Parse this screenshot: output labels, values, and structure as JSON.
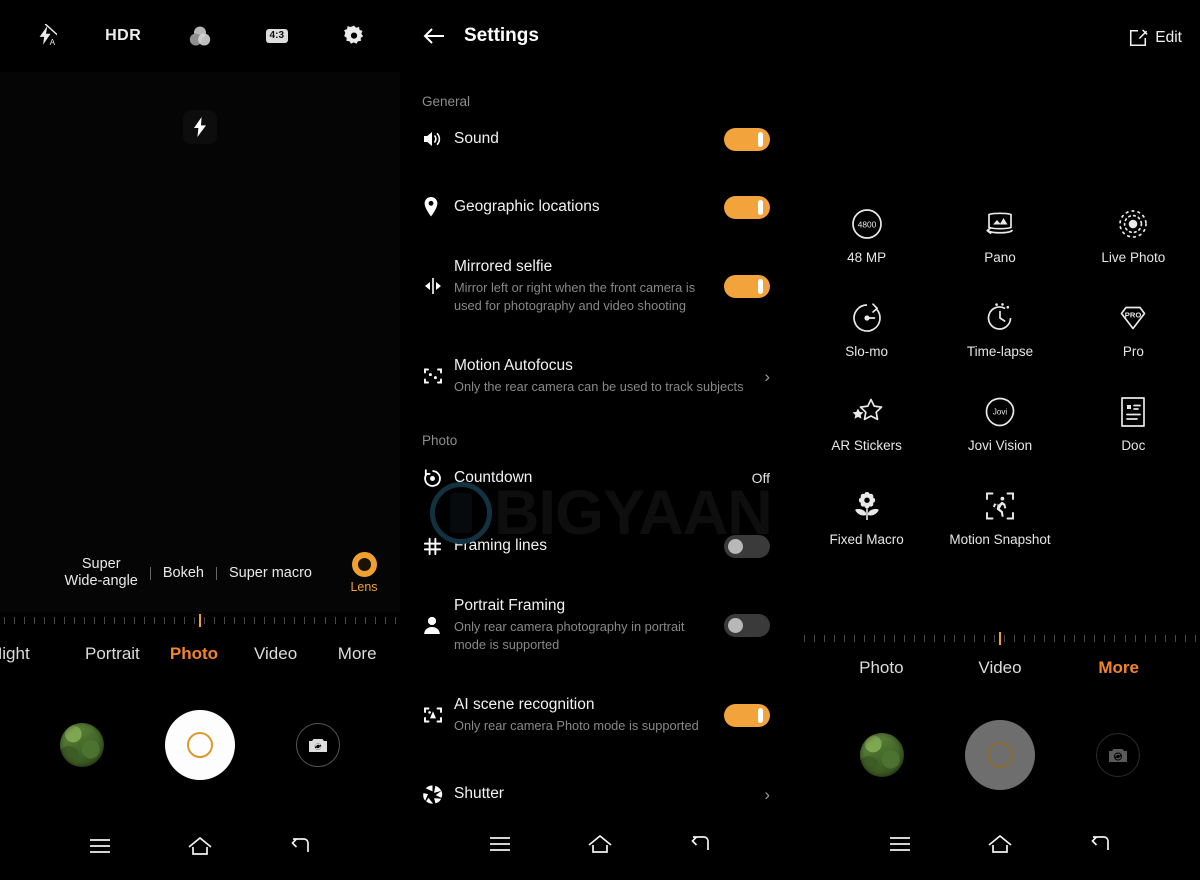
{
  "camera": {
    "topbar": [
      {
        "name": "flash-auto-icon",
        "label": "",
        "icon": "flash-auto"
      },
      {
        "name": "hdr-toggle",
        "label": "HDR",
        "icon": "text"
      },
      {
        "name": "filters-icon",
        "label": "",
        "icon": "filters"
      },
      {
        "name": "aspect-ratio-button",
        "label": "4:3",
        "icon": "ratio"
      },
      {
        "name": "camera-settings-gear",
        "label": "",
        "icon": "gear"
      }
    ],
    "viewfinder_flash_icon": "flash-bolt",
    "lens_options": [
      "Super\nWide-angle",
      "Bokeh",
      "Super macro"
    ],
    "lens_options_flat": [
      "Super Wide-angle",
      "Bokeh",
      "Super macro"
    ],
    "lens_chip_label": "Lens",
    "modes": [
      "Night",
      "Portrait",
      "Photo",
      "Video",
      "More"
    ],
    "active_mode": "Photo",
    "accent_color": "#f0852a",
    "toggle_on_color": "#f3a33c"
  },
  "settings": {
    "title": "Settings",
    "back_icon": "arrow-left-icon",
    "sections": [
      {
        "label": "General",
        "rows": [
          {
            "icon": "speaker-icon",
            "title": "Sound",
            "subtitle": "",
            "control": "toggle",
            "state": "on"
          },
          {
            "icon": "location-pin-icon",
            "title": "Geographic locations",
            "subtitle": "",
            "control": "toggle",
            "state": "on"
          },
          {
            "icon": "mirror-icon",
            "title": "Mirrored selfie",
            "subtitle": "Mirror left or right when the front camera is used for photography and video shooting",
            "control": "toggle",
            "state": "on"
          },
          {
            "icon": "motion-autofocus-icon",
            "title": "Motion Autofocus",
            "subtitle": "Only the rear camera can be used to track subjects",
            "control": "chevron",
            "state": ""
          }
        ]
      },
      {
        "label": "Photo",
        "rows": [
          {
            "icon": "countdown-timer-icon",
            "title": "Countdown",
            "subtitle": "",
            "control": "value",
            "state": "Off"
          },
          {
            "icon": "framing-lines-icon",
            "title": "Framing lines",
            "subtitle": "",
            "control": "toggle",
            "state": "off"
          },
          {
            "icon": "person-icon",
            "title": "Portrait Framing",
            "subtitle": "Only rear camera photography in portrait mode is supported",
            "control": "toggle",
            "state": "off"
          },
          {
            "icon": "ai-scene-icon",
            "title": "AI scene recognition",
            "subtitle": "Only rear camera Photo mode is supported",
            "control": "toggle",
            "state": "on"
          },
          {
            "icon": "shutter-aperture-icon",
            "title": "Shutter",
            "subtitle": "",
            "control": "chevron",
            "state": ""
          }
        ]
      }
    ]
  },
  "more_modes": {
    "edit_label": "Edit",
    "edit_icon": "edit-pencil-square-icon",
    "items": [
      {
        "label": "48 MP",
        "icon": "48mp-icon",
        "badge": "4800"
      },
      {
        "label": "Pano",
        "icon": "pano-icon"
      },
      {
        "label": "Live Photo",
        "icon": "live-photo-icon"
      },
      {
        "label": "Slo-mo",
        "icon": "slomo-icon"
      },
      {
        "label": "Time-lapse",
        "icon": "timelapse-icon"
      },
      {
        "label": "Pro",
        "icon": "pro-icon",
        "badge": "PRO"
      },
      {
        "label": "AR Stickers",
        "icon": "ar-stickers-icon"
      },
      {
        "label": "Jovi Vision",
        "icon": "jovi-vision-icon",
        "badge": "Jovi"
      },
      {
        "label": "Doc",
        "icon": "doc-icon"
      },
      {
        "label": "Fixed Macro",
        "icon": "fixed-macro-icon"
      },
      {
        "label": "Motion Snapshot",
        "icon": "motion-snapshot-icon"
      }
    ],
    "modes": [
      "Photo",
      "Video",
      "More"
    ],
    "active_mode": "More"
  },
  "navbar": {
    "menu": "menu-icon",
    "home": "home-icon",
    "back": "back-icon"
  },
  "watermark": {
    "text": "BIGYAAN"
  }
}
